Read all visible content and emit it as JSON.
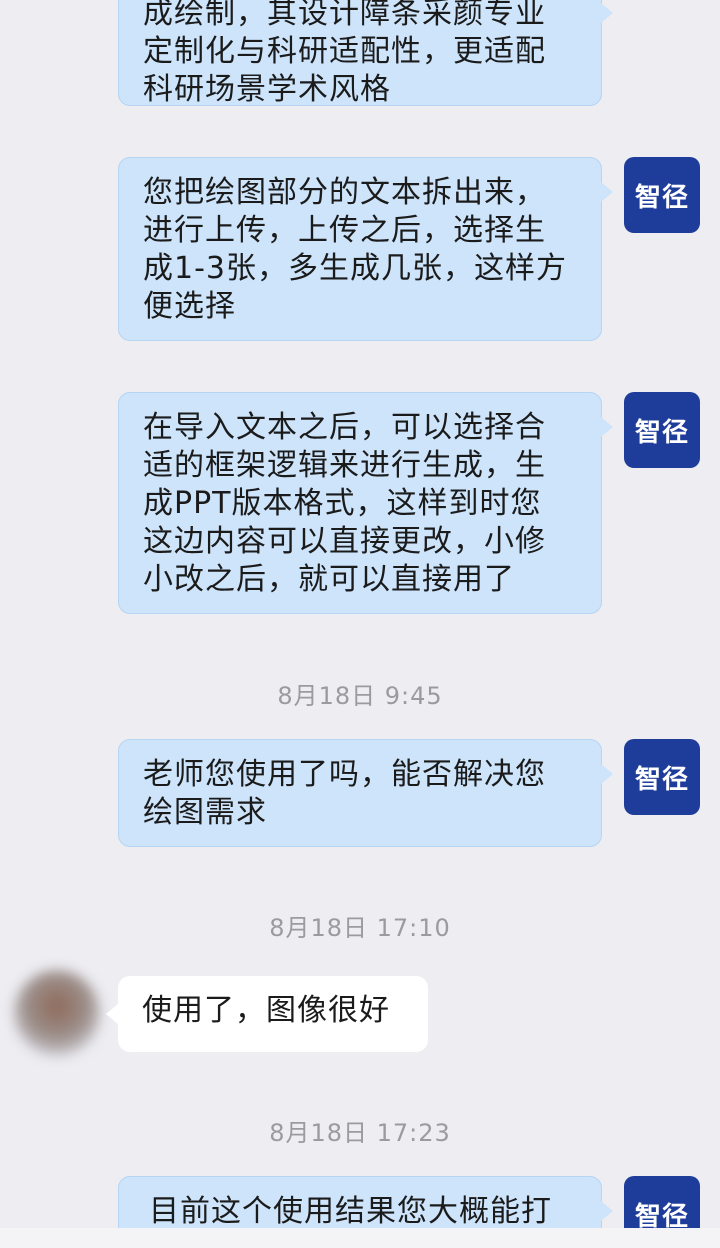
{
  "messages": {
    "m1": "成绘制，其设计障条采颜专业\n定制化与科研适配性，更适配\n科研场景学术风格",
    "m2": "您把绘图部分的文本拆出来，\n进行上传，上传之后，选择生\n成1-3张，多生成几张，这样方\n便选择",
    "m3": "在导入文本之后，可以选择合\n适的框架逻辑来进行生成，生\n成PPT版本格式，这样到时您\n这边内容可以直接更改，小修\n小改之后，就可以直接用了",
    "m4": "老师您使用了吗，能否解决您\n绘图需求",
    "m5": "使用了，图像很好",
    "m6": "目前这个使用结果您大概能打"
  },
  "timestamps": {
    "t1": "8月18日  9:45",
    "t2": "8月18日  17:10",
    "t3": "8月18日  17:23"
  },
  "avatar": {
    "brand_label": "智径",
    "brand_color": "#1e3c9a"
  },
  "colors": {
    "background": "#ededf2",
    "outgoing_bubble": "#cde4fb",
    "incoming_bubble": "#ffffff"
  }
}
